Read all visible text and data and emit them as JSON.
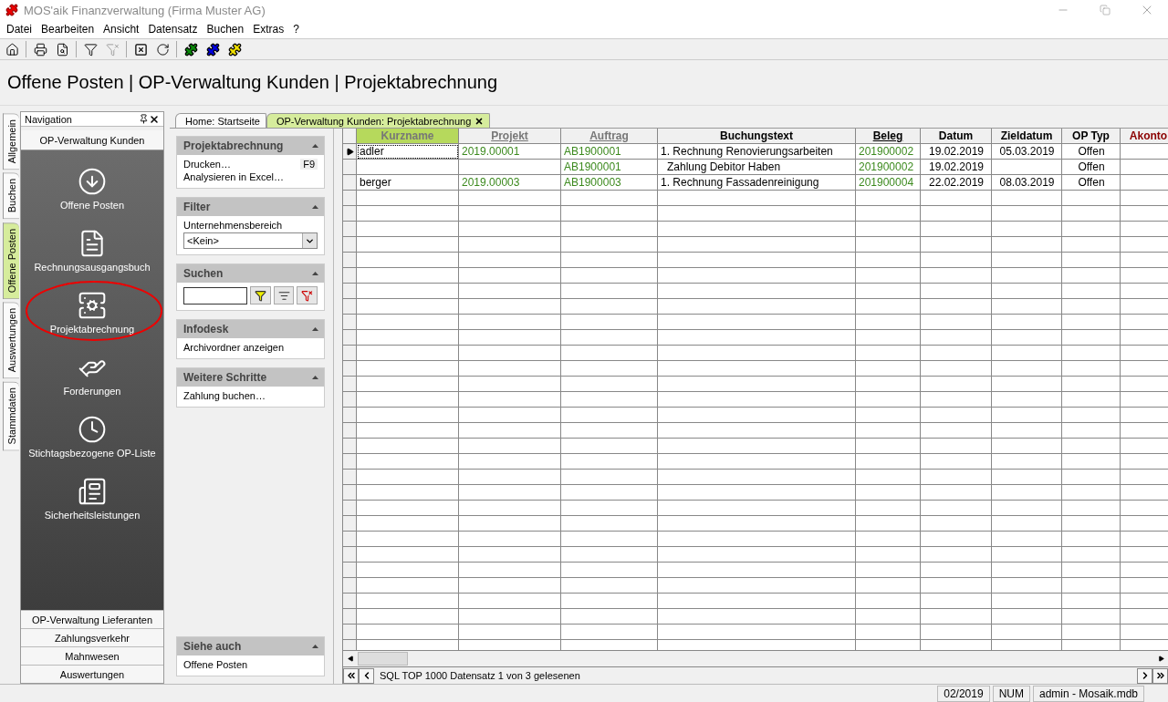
{
  "window": {
    "title": "MOS'aik Finanzverwaltung (Firma Muster AG)"
  },
  "menu": [
    "Datei",
    "Bearbeiten",
    "Ansicht",
    "Datensatz",
    "Buchen",
    "Extras",
    "?"
  ],
  "heading": "Offene Posten | OP-Verwaltung Kunden | Projektabrechnung",
  "side_tabs": [
    {
      "label": "Allgemein",
      "selected": false
    },
    {
      "label": "Buchen",
      "selected": false
    },
    {
      "label": "Offene Posten",
      "selected": true
    },
    {
      "label": "Auswertungen",
      "selected": false
    },
    {
      "label": "Stammdaten",
      "selected": false
    }
  ],
  "navigation": {
    "title": "Navigation",
    "group": "OP-Verwaltung Kunden",
    "items": [
      {
        "label": "Offene Posten",
        "highlighted": false
      },
      {
        "label": "Rechnungsausgangsbuch",
        "highlighted": false
      },
      {
        "label": "Projektabrechnung",
        "highlighted": true
      },
      {
        "label": "Forderungen",
        "highlighted": false
      },
      {
        "label": "Stichtagsbezogene OP-Liste",
        "highlighted": false
      },
      {
        "label": "Sicherheitsleistungen",
        "highlighted": false
      }
    ],
    "groups_below": [
      "OP-Verwaltung Lieferanten",
      "Zahlungsverkehr",
      "Mahnwesen",
      "Auswertungen"
    ]
  },
  "doc_tabs": [
    {
      "label": "Home: Startseite",
      "selected": false
    },
    {
      "label": "OP-Verwaltung Kunden: Projektabrechnung",
      "selected": true
    }
  ],
  "task_pane": [
    {
      "kind": "links",
      "title": "Projektabrechnung",
      "expanded": true,
      "items": [
        {
          "label": "Drucken…",
          "shortcut": "F9"
        },
        {
          "label": "Analysieren in Excel…"
        }
      ]
    },
    {
      "kind": "filter",
      "title": "Filter",
      "expanded": true,
      "label": "Unternehmensbereich",
      "value": "<Kein>"
    },
    {
      "kind": "search",
      "title": "Suchen",
      "expanded": true
    },
    {
      "kind": "links",
      "title": "Infodesk",
      "expanded": true,
      "items": [
        {
          "label": "Archivordner anzeigen"
        }
      ]
    },
    {
      "kind": "links",
      "title": "Weitere Schritte",
      "expanded": true,
      "items": [
        {
          "label": "Zahlung buchen…"
        }
      ]
    },
    {
      "kind": "footer",
      "title": "Siehe auch",
      "expanded": true,
      "items": [
        {
          "label": "Offene Posten"
        }
      ]
    }
  ],
  "table": {
    "columns": [
      {
        "label": "Kurzname",
        "kind": "sorted"
      },
      {
        "label": "Projekt",
        "kind": "link-muted"
      },
      {
        "label": "Auftrag",
        "kind": "link-muted"
      },
      {
        "label": "Buchungstext",
        "kind": "plain"
      },
      {
        "label": "Beleg",
        "kind": "link"
      },
      {
        "label": "Datum",
        "kind": "plain"
      },
      {
        "label": "Zieldatum",
        "kind": "plain"
      },
      {
        "label": "OP Typ",
        "kind": "plain"
      },
      {
        "label": "Akonto",
        "kind": "alert"
      }
    ],
    "rows": [
      {
        "current": true,
        "kind": "main",
        "cells": [
          "adler",
          "2019.00001",
          "AB1900001",
          "1. Rechnung Renovierungsarbeiten",
          "201900002",
          "19.02.2019",
          "05.03.2019",
          "Offen",
          null
        ]
      },
      {
        "current": false,
        "kind": "payment",
        "cells": [
          null,
          null,
          "AB1900001",
          "Zahlung Debitor Haben",
          "201900002",
          "19.02.2019",
          null,
          "Offen",
          null
        ]
      },
      {
        "current": false,
        "kind": "main",
        "cells": [
          "berger",
          "2019.00003",
          "AB1900003",
          "1. Rechnung Fassadenreinigung",
          "201900004",
          "22.02.2019",
          "08.03.2019",
          "Offen",
          null
        ]
      }
    ],
    "record_info": "SQL TOP 1000 Datensatz 1 von 3 gelesenen"
  },
  "status_bar": [
    "02/2019",
    "NUM",
    "admin - Mosaik.mdb"
  ]
}
